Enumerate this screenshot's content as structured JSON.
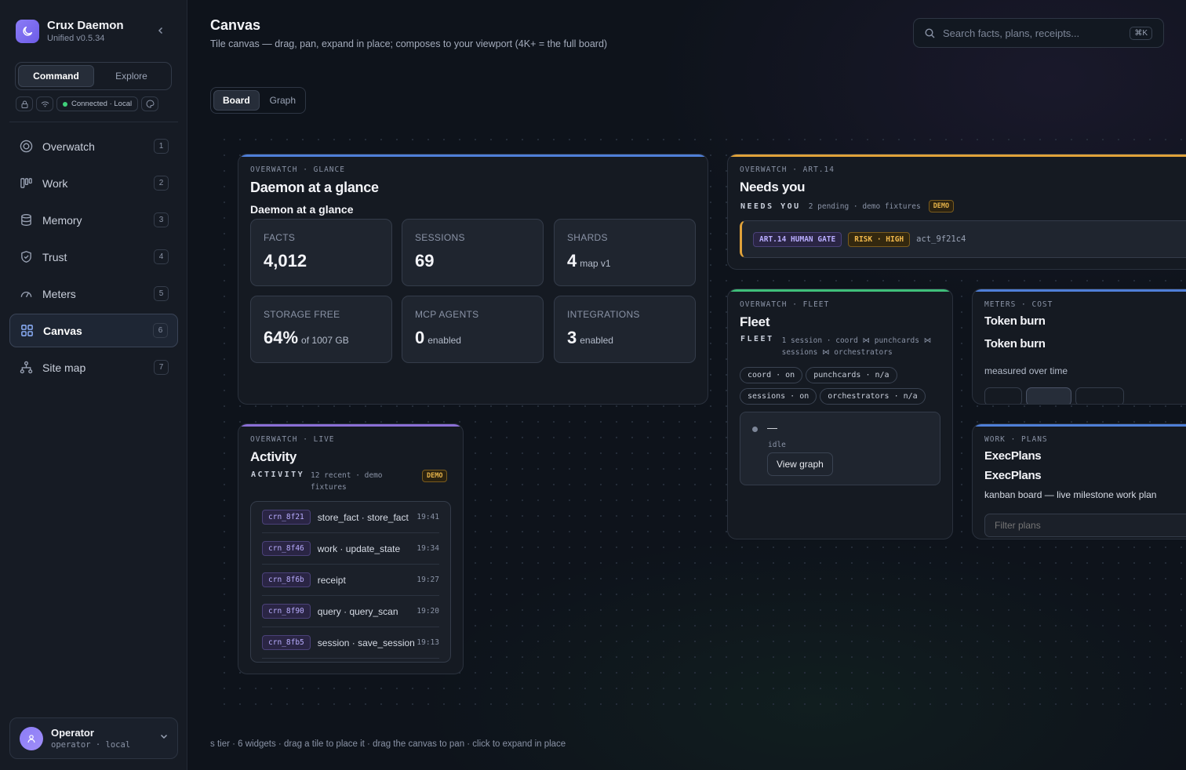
{
  "brand": {
    "name": "Crux Daemon",
    "version": "Unified v0.5.34"
  },
  "mode_switch": {
    "command": "Command",
    "explore": "Explore"
  },
  "connection": {
    "label": "Connected · Local"
  },
  "nav": [
    {
      "label": "Overwatch",
      "key": "1",
      "icon": "target-icon"
    },
    {
      "label": "Work",
      "key": "2",
      "icon": "kanban-icon"
    },
    {
      "label": "Memory",
      "key": "3",
      "icon": "database-icon"
    },
    {
      "label": "Trust",
      "key": "4",
      "icon": "shield-icon"
    },
    {
      "label": "Meters",
      "key": "5",
      "icon": "gauge-icon"
    },
    {
      "label": "Canvas",
      "key": "6",
      "icon": "grid-icon",
      "active": true
    },
    {
      "label": "Site map",
      "key": "7",
      "icon": "sitemap-icon"
    }
  ],
  "user": {
    "name": "Operator",
    "sub": "operator · local"
  },
  "header": {
    "title": "Canvas",
    "subtitle": "Tile canvas — drag, pan, expand in place; composes to your viewport (4K+ = the full board)"
  },
  "search": {
    "placeholder": "Search facts, plans, receipts...",
    "shortcut": "⌘K"
  },
  "view_tabs": {
    "board": "Board",
    "graph": "Graph"
  },
  "tiles": {
    "glance": {
      "eyebrow": "OVERWATCH · GLANCE",
      "title": "Daemon at a glance",
      "subtitle": "Daemon at a glance",
      "accent": "#4f7fd8",
      "stats": [
        {
          "label": "FACTS",
          "value": "4,012",
          "unit": ""
        },
        {
          "label": "SESSIONS",
          "value": "69",
          "unit": ""
        },
        {
          "label": "SHARDS",
          "value": "4",
          "unit": "map v1"
        },
        {
          "label": "STORAGE FREE",
          "value": "64%",
          "unit": "of 1007 GB"
        },
        {
          "label": "MCP AGENTS",
          "value": "0",
          "unit": "enabled"
        },
        {
          "label": "INTEGRATIONS",
          "value": "3",
          "unit": "enabled"
        }
      ]
    },
    "needs": {
      "eyebrow": "OVERWATCH · ART.14",
      "title": "Needs you",
      "caps": "NEEDS YOU",
      "meta": "2 pending · demo fixtures",
      "demo": "DEMO",
      "accent": "#e0a23a",
      "gate_tag": "ART.14 HUMAN GATE",
      "risk_tag": "RISK · HIGH",
      "action_id": "act_9f21c4"
    },
    "fleet": {
      "eyebrow": "OVERWATCH · FLEET",
      "title": "Fleet",
      "caps": "FLEET",
      "meta_line1": "1 session · coord ⋈ punchcards ⋈",
      "meta_line2": "sessions ⋈ orchestrators",
      "accent": "#3fbf7a",
      "pills": [
        "coord · on",
        "punchcards · n/a",
        "sessions · on",
        "orchestrators · n/a"
      ],
      "node_name": "—",
      "node_state": "idle",
      "view_graph": "View graph"
    },
    "token": {
      "eyebrow": "METERS · COST",
      "title": "Token burn",
      "subtitle": "Token burn",
      "desc": "measured over time",
      "accent": "#4f7fd8"
    },
    "activity": {
      "eyebrow": "OVERWATCH · LIVE",
      "title": "Activity",
      "caps": "ACTIVITY",
      "meta_line1": "12 recent · demo",
      "meta_line2": "fixtures",
      "demo": "DEMO",
      "accent": "#8b6fd6",
      "rows": [
        {
          "id": "crn_8f21",
          "label": "store_fact · store_fact",
          "time": "19:41"
        },
        {
          "id": "crn_8f46",
          "label": "work · update_state",
          "time": "19:34"
        },
        {
          "id": "crn_8f6b",
          "label": "receipt",
          "time": "19:27"
        },
        {
          "id": "crn_8f90",
          "label": "query · query_scan",
          "time": "19:20"
        },
        {
          "id": "crn_8fb5",
          "label": "session · save_session",
          "time": "19:13"
        }
      ]
    },
    "plans": {
      "eyebrow": "WORK · PLANS",
      "title": "ExecPlans",
      "subtitle": "ExecPlans",
      "desc": "kanban board — live milestone work plan",
      "filter_placeholder": "Filter plans",
      "accent": "#4f7fd8"
    }
  },
  "footer": "s tier · 6 widgets · drag a tile to place it · drag the canvas to pan · click to expand in place"
}
